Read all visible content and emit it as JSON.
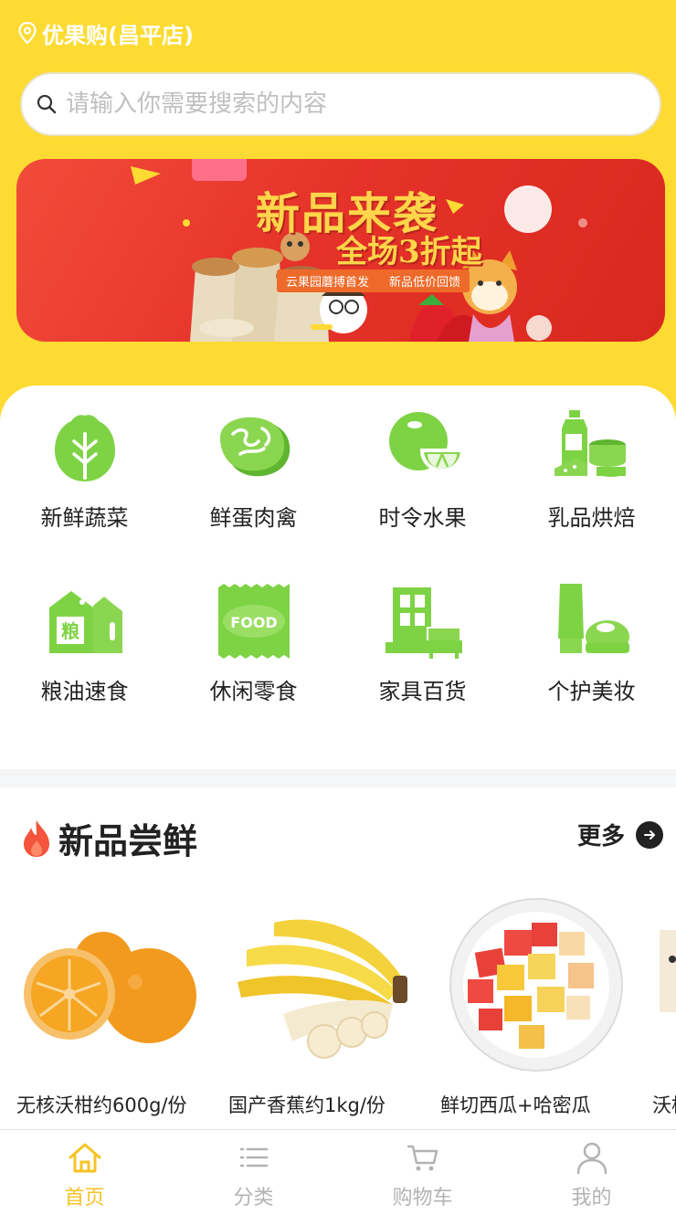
{
  "header": {
    "store_name": "优果购(昌平店)"
  },
  "search": {
    "placeholder": "请输入你需要搜索的内容"
  },
  "banner": {
    "title": "新品来袭",
    "subtitle": "全场3折起",
    "ribbon_left": "云果园蘑搏首发",
    "ribbon_right": "新品低价回馈"
  },
  "categories": [
    {
      "label": "新鲜蔬菜",
      "icon": "vegetable-icon"
    },
    {
      "label": "鲜蛋肉禽",
      "icon": "meat-icon"
    },
    {
      "label": "时令水果",
      "icon": "fruit-icon"
    },
    {
      "label": "乳品烘焙",
      "icon": "dairy-icon"
    },
    {
      "label": "粮油速食",
      "icon": "grain-icon"
    },
    {
      "label": "休闲零食",
      "icon": "snack-icon"
    },
    {
      "label": "家具百货",
      "icon": "furniture-icon"
    },
    {
      "label": "个护美妆",
      "icon": "cosmetics-icon"
    }
  ],
  "section": {
    "title": "新品尝鲜",
    "more": "更多"
  },
  "products": [
    {
      "name": "无核沃柑约600g/份"
    },
    {
      "name": "国产香蕉约1kg/份"
    },
    {
      "name": "鲜切西瓜+哈密瓜"
    },
    {
      "name": "沃柑"
    }
  ],
  "tabbar": [
    {
      "label": "首页",
      "active": true
    },
    {
      "label": "分类",
      "active": false
    },
    {
      "label": "购物车",
      "active": false
    },
    {
      "label": "我的",
      "active": false
    }
  ],
  "colors": {
    "accent": "#FDDB32",
    "green": "#7ED345",
    "active_tab": "#F7C325"
  }
}
